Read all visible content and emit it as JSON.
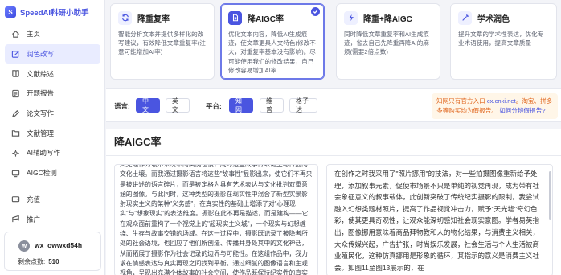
{
  "app": {
    "title": "SpeedAI科研小助手",
    "logo_letter": "S"
  },
  "sidebar": {
    "items": [
      {
        "label": "主页",
        "icon": "home-icon"
      },
      {
        "label": "润色改写",
        "icon": "edit-icon",
        "active": true
      },
      {
        "label": "文献综述",
        "icon": "book-icon"
      },
      {
        "label": "开题报告",
        "icon": "report-icon"
      },
      {
        "label": "论文写作",
        "icon": "pen-icon"
      },
      {
        "label": "文献管理",
        "icon": "folder-icon"
      },
      {
        "label": "AI辅助写作",
        "icon": "ai-assist-icon"
      },
      {
        "label": "AIGC检测",
        "icon": "detect-icon"
      },
      {
        "label": "充值",
        "icon": "wallet-icon"
      },
      {
        "label": "推广",
        "icon": "share-icon"
      }
    ],
    "user": {
      "avatar_letter": "W",
      "name": "wx_owwxd54h",
      "points_label": "剩余点数:",
      "points_value": "510"
    }
  },
  "modes": [
    {
      "title": "降重复率",
      "icon": "refresh-icon",
      "desc": "智能分析文本并提供多样化的改写建议，有效降低文章重复率(注意可能增加AI率)"
    },
    {
      "title": "降AIGC率",
      "icon": "document-icon",
      "selected": true,
      "desc": "优化文本内容，降低AI生成痕迹，使文章更具人文特色(修改不大，对重复率基本没有影响)。尽可能使用我们的修改结果，自己修改容易增加AI率"
    },
    {
      "title": "降重+降AIGC",
      "icon": "bolt-icon",
      "desc": "同时降低文章重复率和AI生成痕迹，省去自己先降重再降AI的麻烦(需要2倍点数)"
    },
    {
      "title": "学术润色",
      "icon": "magic-wand-icon",
      "desc": "提升文章的学术性表达，优化专业术语使用，提高文章质量"
    }
  ],
  "options": {
    "language_label": "语言:",
    "languages": [
      {
        "label": "中文",
        "on": true
      },
      {
        "label": "英文",
        "on": false
      }
    ],
    "platform_label": "平台:",
    "platforms": [
      {
        "label": "知网",
        "on": true
      },
      {
        "label": "维普",
        "on": false
      },
      {
        "label": "格子达",
        "on": false
      }
    ],
    "notice_prefix": "知网只有官方入口",
    "notice_domain": "cx.cnki.net",
    "notice_mid": "。淘宝、拼多多等购买均为假报告。",
    "notice_link": "如何分辨假报告?"
  },
  "result": {
    "title": "降AIGC率",
    "original_text": "天光题作为城市系统中的实例也谈，成为这些故事传以诞生与传播的文化土壤。而我通过摄影语言将这些\"故事性\"显影出来，使它们不再只是被讲述的语言碎片，而是被定格为具有艺术表达与文化批判双重意涵的图像。与此同时，这种类型的摄影在现实性中混合了新型实景影射现实主义的某种\"义务感\"，在真实性的基础上增添了对\"心理现实\"与\"想象现实\"的表达维度。摄影在此不再是描述，而是建构——它在观众面前重构了一个视觉上的\"超现实主义城\"，一个现实与幻想缠绕、生存与故事交错的场域。在这一过程中，摄影既记录了被隐者所处的社会语境，也回应了他们所创造、传播并身处其中的文化神话，从而拓展了摄影作为社会记录的边界与可能性。在这组作品中，我力求在情感表达与真实再现之间找到平衡。通过细腻的图像语言和主观视角，呈现出充满个体故事的社会空间，使作品既保持纪实性的真实性，又具备艺术表现的情感深度。",
    "rewritten_text": "在创作之时我采用了\"照片挪用\"的技法，对一些拍摄图像重新给予处理，添加叙事元素，促使市场景不只是单纯的视觉再现，成为带有社会象征意义的叙事载体，此创新突破了传统纪实摄影的限制，我尝试融入幻想类题材照片，提高了作品视觉冲击力，赋予\"天光墟\"奇幻色彩，使其更具奇观性，让观众能深切感知社会现实意图。学者易英指出，图像挪用意味着商品拜物教和人的物化结果，与消费主义相关，大众传媒兴起，广告扩张，时尚娱乐发展，社会生活与个人生活被商业殖民化，这种仿真挪用是形象的循环，其指示的意义是消费主义社会。如图11至图13展示的，在"
  }
}
